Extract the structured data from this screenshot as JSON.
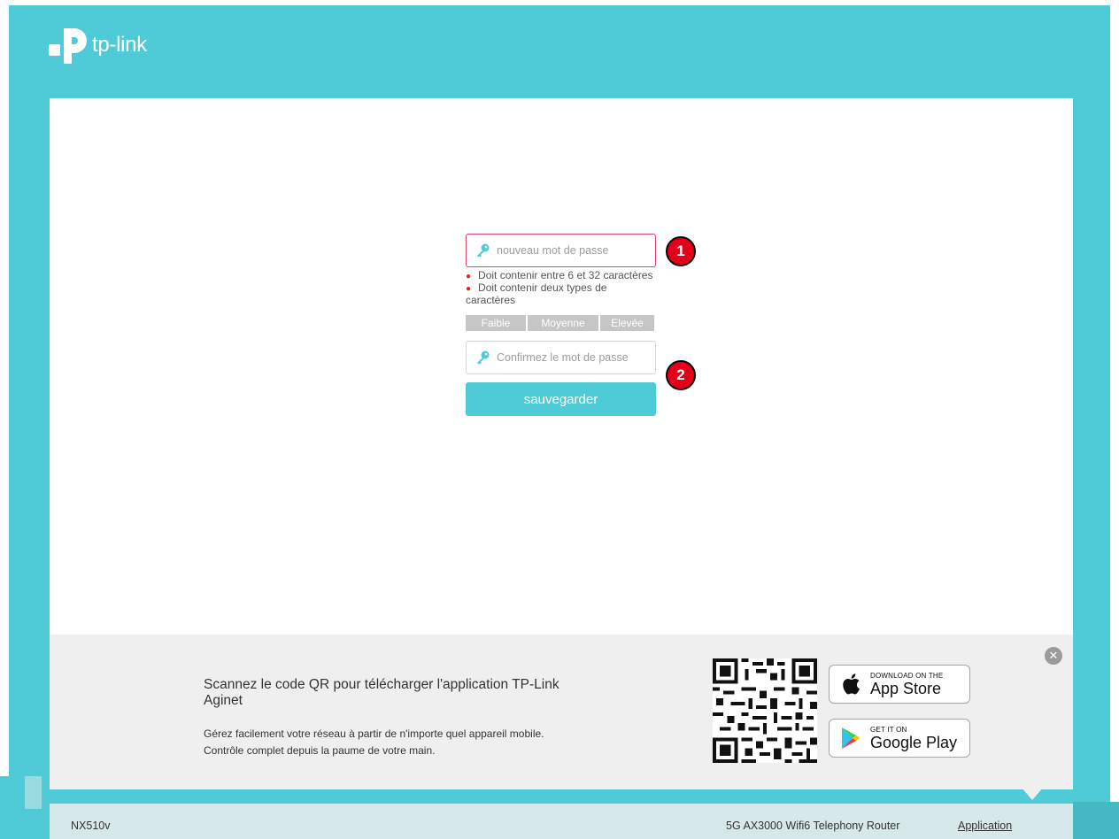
{
  "brand": {
    "logo_text": "tp-link",
    "accent_color": "#4ecbd6",
    "error_color": "#e0232a"
  },
  "form": {
    "new_password": {
      "placeholder": "nouveau mot de passe",
      "icon": "key-icon"
    },
    "rules": [
      "Doit contenir entre 6 et 32 caractères",
      "Doit contenir deux types de caractères"
    ],
    "strength": {
      "weak": "Faible",
      "medium": "Moyenne",
      "high": "Elevée"
    },
    "confirm_password": {
      "placeholder": "Confirmez le mot de passe",
      "icon": "key-icon"
    },
    "save_label": "sauvegarder"
  },
  "annotations": {
    "badge1": "1",
    "badge2": "2"
  },
  "promo": {
    "title": "Scannez le code QR pour télécharger l'application TP-Link Aginet",
    "description": "Gérez facilement votre réseau à partir de n'importe quel appareil mobile. Contrôle complet depuis la paume de votre main.",
    "app_store": {
      "small": "DOWNLOAD ON THE",
      "big": "App Store"
    },
    "google_play": {
      "small": "GET IT ON",
      "big": "Google Play"
    }
  },
  "footer": {
    "model": "NX510v",
    "router": "5G AX3000 Wifi6 Telephony Router",
    "app_link": "Application"
  }
}
